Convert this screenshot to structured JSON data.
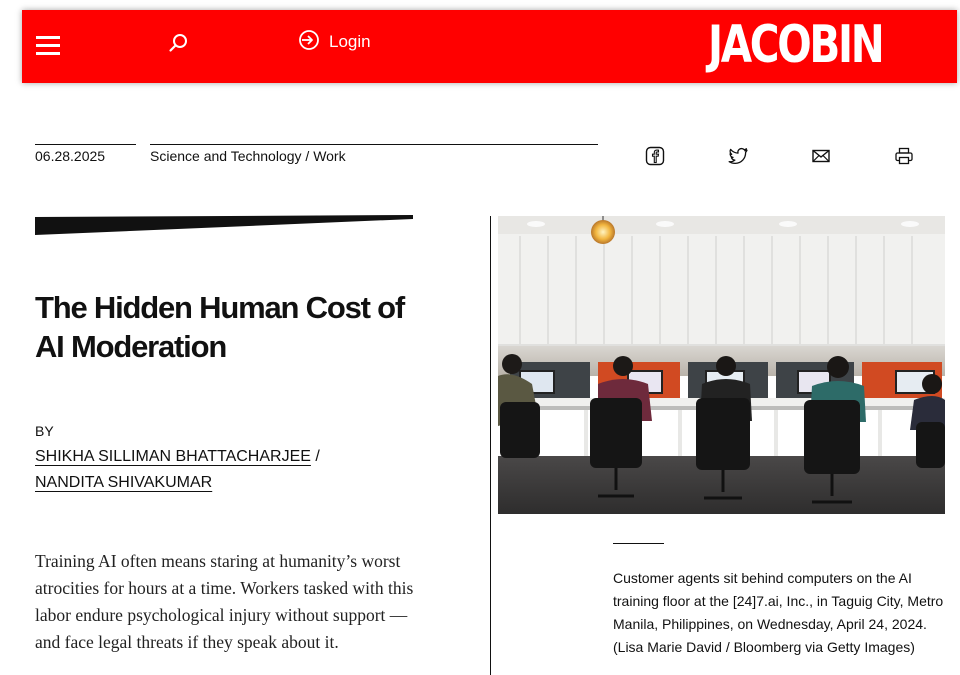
{
  "header": {
    "login_label": "Login",
    "logo_text": "JACOBIN",
    "brand_color": "#ff0000",
    "icons": [
      "menu-icon",
      "search-icon",
      "login-icon"
    ]
  },
  "meta": {
    "date": "06.28.2025",
    "categories": "Science and Technology / Work",
    "share_icons": [
      "facebook-icon",
      "twitter-icon",
      "email-icon",
      "print-icon"
    ]
  },
  "article": {
    "title": "The Hidden Human Cost of AI Moderation",
    "byline_prefix": "BY",
    "authors": [
      "SHIKHA SILLIMAN BHATTACHARJEE",
      "NANDITA SHIVAKUMAR"
    ],
    "author_separator": " /",
    "dek": "Training AI often means staring at humanity’s worst atrocities for hours at a time. Workers tasked with this labor endure psychological injury without support — and face legal threats if they speak about it."
  },
  "image": {
    "caption": "Customer agents sit behind computers on the AI training floor at the [24]7.ai, Inc., in Taguig City, Metro Manila, Philippines, on Wednesday, April 24, 2024. (Lisa Marie David / Bloomberg via Getty Images)"
  }
}
